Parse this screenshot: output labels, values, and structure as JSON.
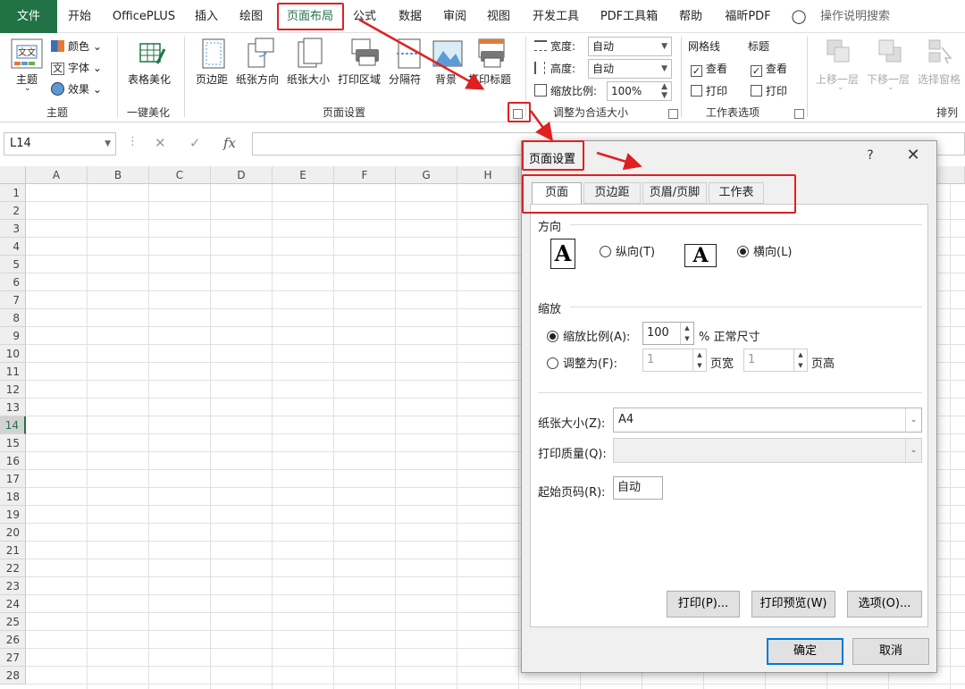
{
  "menu": [
    "文件",
    "开始",
    "OfficePLUS",
    "插入",
    "绘图",
    "页面布局",
    "公式",
    "数据",
    "审阅",
    "视图",
    "开发工具",
    "PDF工具箱",
    "帮助",
    "福昕PDF",
    "操作说明搜索"
  ],
  "ribbon": {
    "theme_group": {
      "label": "主题",
      "themes": "主题",
      "colors": "颜色",
      "fonts": "字体",
      "effects": "效果"
    },
    "beautify_group": {
      "label": "一键美化",
      "table_beautify": "表格美化"
    },
    "page_setup_group": {
      "label": "页面设置",
      "buttons": [
        "页边距",
        "纸张方向",
        "纸张大小",
        "打印区域",
        "分隔符",
        "背景",
        "打印标题"
      ]
    },
    "scale_group": {
      "label": "调整为合适大小",
      "width_label": "宽度:",
      "width_value": "自动",
      "height_label": "高度:",
      "height_value": "自动",
      "scale_label": "缩放比例:",
      "scale_value": "100%"
    },
    "sheet_options_group": {
      "label": "工作表选项",
      "gridlines": "网格线",
      "headings": "标题",
      "view": "查看",
      "print": "打印"
    },
    "arrange_group": {
      "label": "排列",
      "bring_forward": "上移一层",
      "send_backward": "下移一层",
      "selection_pane": "选择窗格"
    }
  },
  "formula_bar": {
    "name_box": "L14",
    "fx": "fx"
  },
  "sheet": {
    "columns": [
      "A",
      "B",
      "C",
      "D",
      "E",
      "F",
      "G",
      "H"
    ],
    "rows": [
      "1",
      "2",
      "3",
      "4",
      "5",
      "6",
      "7",
      "8",
      "9",
      "10",
      "11",
      "12",
      "13",
      "14",
      "15",
      "16",
      "17",
      "18",
      "19",
      "20",
      "21",
      "22",
      "23",
      "24",
      "25",
      "26",
      "27",
      "28"
    ],
    "selected_row": "14"
  },
  "dialog": {
    "title": "页面设置",
    "help": "?",
    "close": "✕",
    "tabs": [
      "页面",
      "页边距",
      "页眉/页脚",
      "工作表"
    ],
    "active_tab": "页面",
    "orientation": {
      "section": "方向",
      "portrait": "纵向(T)",
      "landscape": "横向(L)",
      "selected": "landscape"
    },
    "scaling": {
      "section": "缩放",
      "adjust_to": "缩放比例(A):",
      "adjust_value": "100",
      "adjust_suffix": "% 正常尺寸",
      "fit_to": "调整为(F):",
      "pages_wide_value": "1",
      "pages_wide": "页宽",
      "pages_tall_value": "1",
      "pages_tall": "页高",
      "selected": "adjust_to"
    },
    "paper_size_label": "纸张大小(Z):",
    "paper_size_value": "A4",
    "print_quality_label": "打印质量(Q):",
    "print_quality_value": "",
    "first_page_label": "起始页码(R):",
    "first_page_value": "自动",
    "buttons": {
      "print": "打印(P)...",
      "preview": "打印预览(W)",
      "options": "选项(O)...",
      "ok": "确定",
      "cancel": "取消"
    }
  },
  "colors": {
    "excel_green": "#217346",
    "highlight_red": "#e02020",
    "focus_blue": "#0078d7"
  }
}
